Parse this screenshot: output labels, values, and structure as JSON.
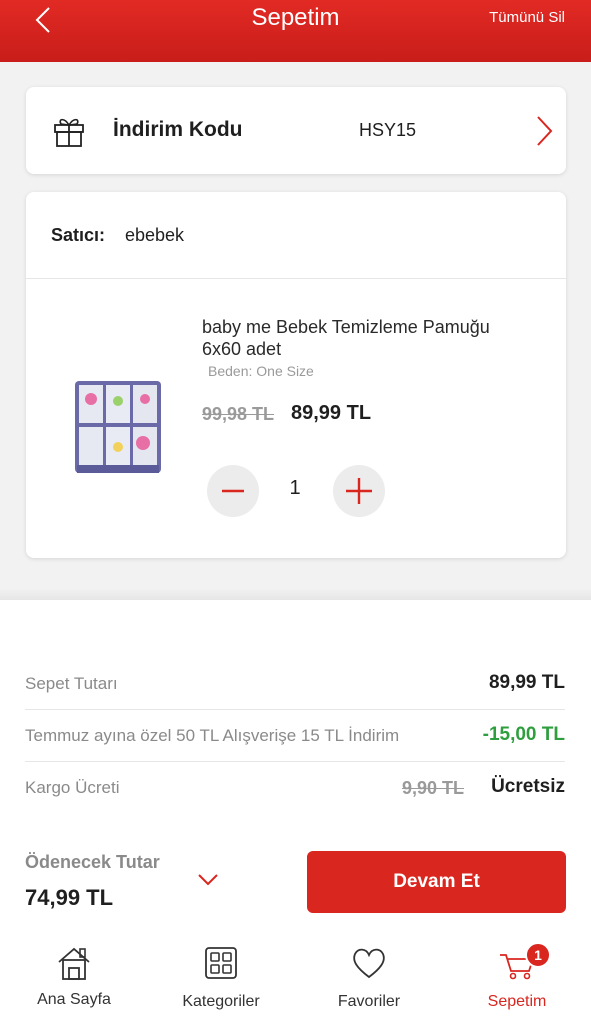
{
  "header": {
    "title": "Sepetim",
    "clear_all": "Tümünü Sil"
  },
  "discount": {
    "label": "İndirim Kodu",
    "code": "HSY15"
  },
  "seller": {
    "key": "Satıcı:",
    "value": "ebebek"
  },
  "product": {
    "name": "baby me Bebek Temizleme Pamuğu 6x60 adet",
    "size": "Beden: One Size",
    "old_price": "99,98 TL",
    "price": "89,99 TL",
    "quantity": "1"
  },
  "summary": {
    "basket_label": "Sepet Tutarı",
    "basket_value": "89,99 TL",
    "promo_label": "Temmuz ayına özel 50 TL Alışverişe 15 TL İndirim",
    "promo_value": "-15,00 TL",
    "shipping_label": "Kargo Ücreti",
    "shipping_old": "9,90 TL",
    "shipping_value": "Ücretsiz"
  },
  "payment": {
    "label": "Ödenecek Tutar",
    "total": "74,99 TL",
    "continue": "Devam Et"
  },
  "nav": {
    "home": "Ana Sayfa",
    "categories": "Kategoriler",
    "favorites": "Favoriler",
    "cart": "Sepetim",
    "cart_badge": "1"
  },
  "colors": {
    "brand_red": "#d9261f",
    "discount_green": "#2e9e3e"
  }
}
